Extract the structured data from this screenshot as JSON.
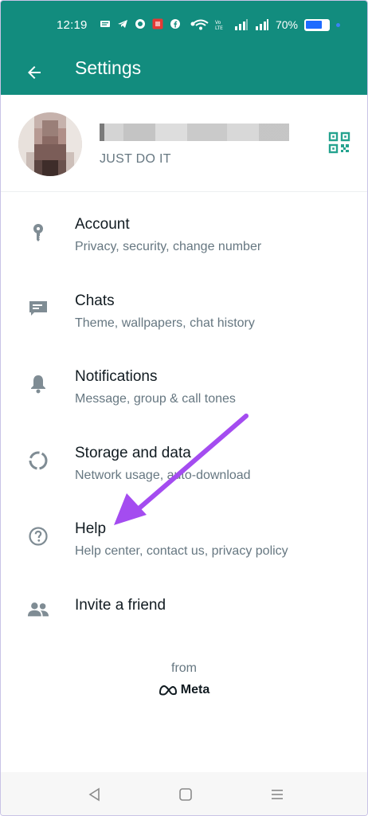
{
  "status_bar": {
    "time": "12:19",
    "battery_percent": "70%",
    "battery_level": 0.7,
    "notification_icons": [
      "message-icon",
      "telegram-icon",
      "whatsapp-icon",
      "app-red-icon",
      "facebook-icon",
      "dot-icon"
    ],
    "system_icons": [
      "wifi-icon",
      "volte-icon",
      "signal-icon",
      "signal-icon"
    ]
  },
  "app_bar": {
    "title": "Settings",
    "back_icon": "arrow-left-icon"
  },
  "profile": {
    "status": "JUST DO IT",
    "qr_icon": "qr-code-icon"
  },
  "menu": {
    "items": [
      {
        "title": "Account",
        "subtitle": "Privacy, security, change number",
        "icon": "key-icon"
      },
      {
        "title": "Chats",
        "subtitle": "Theme, wallpapers, chat history",
        "icon": "chat-icon"
      },
      {
        "title": "Notifications",
        "subtitle": "Message, group & call tones",
        "icon": "bell-icon"
      },
      {
        "title": "Storage and data",
        "subtitle": "Network usage, auto-download",
        "icon": "storage-icon"
      },
      {
        "title": "Help",
        "subtitle": "Help center, contact us, privacy policy",
        "icon": "help-icon"
      },
      {
        "title": "Invite a friend",
        "subtitle": "",
        "icon": "people-icon"
      }
    ]
  },
  "footer": {
    "from": "from",
    "brand": "Meta"
  },
  "colors": {
    "primary": "#128c7e",
    "accent": "#25d366",
    "icon": "#7f8c94",
    "annotation": "#a44cf0"
  }
}
